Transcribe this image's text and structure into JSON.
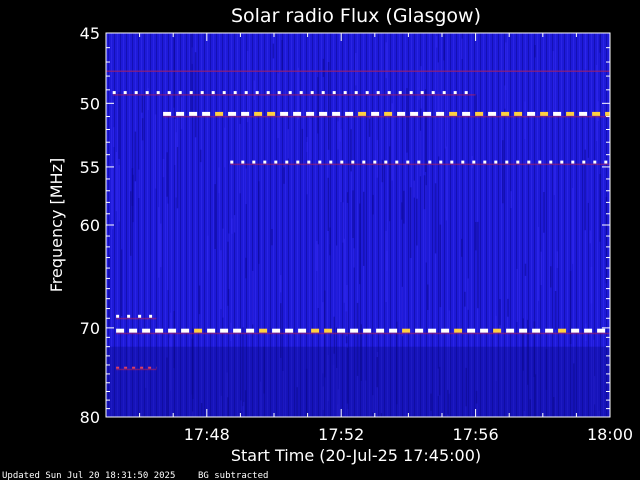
{
  "chart_data": {
    "type": "heatmap",
    "title": "Solar radio Flux (Glasgow)",
    "xlabel": "Start Time (20-Jul-25 17:45:00)",
    "ylabel": "Frequency [MHz]",
    "x_range_minutes": [
      0,
      15
    ],
    "x_tick_labels": [
      {
        "label": "17:48",
        "minutes": 3
      },
      {
        "label": "17:52",
        "minutes": 7
      },
      {
        "label": "17:56",
        "minutes": 11
      },
      {
        "label": "18:00",
        "minutes": 15
      }
    ],
    "ylim": [
      45,
      80
    ],
    "y_inverted": true,
    "y_scale": "log",
    "y_tick_labels": [
      45,
      50,
      55,
      60,
      70,
      80
    ],
    "colormap": "blue-red-white",
    "background_color": "#1a1ad2",
    "interference_bands_mhz": [
      {
        "freq": 49.2,
        "start_min": 0.2,
        "end_min": 11.0,
        "intensity": "dashed-white"
      },
      {
        "freq": 50.8,
        "start_min": 1.7,
        "end_min": 15.0,
        "intensity": "strong-white"
      },
      {
        "freq": 54.6,
        "start_min": 3.7,
        "end_min": 15.0,
        "intensity": "dashed-white"
      },
      {
        "freq": 68.8,
        "start_min": 0.3,
        "end_min": 1.5,
        "intensity": "dashed-white"
      },
      {
        "freq": 70.3,
        "start_min": 0.3,
        "end_min": 15.0,
        "intensity": "strong-white"
      },
      {
        "freq": 74.3,
        "start_min": 0.3,
        "end_min": 1.5,
        "intensity": "faint-red"
      }
    ]
  },
  "footer": {
    "updated": "Updated Sun Jul 20 18:31:50 2025",
    "note": "BG subtracted"
  },
  "colors": {
    "background": "#000000",
    "plot_base": "#1a1ad2",
    "text": "#ffffff"
  }
}
